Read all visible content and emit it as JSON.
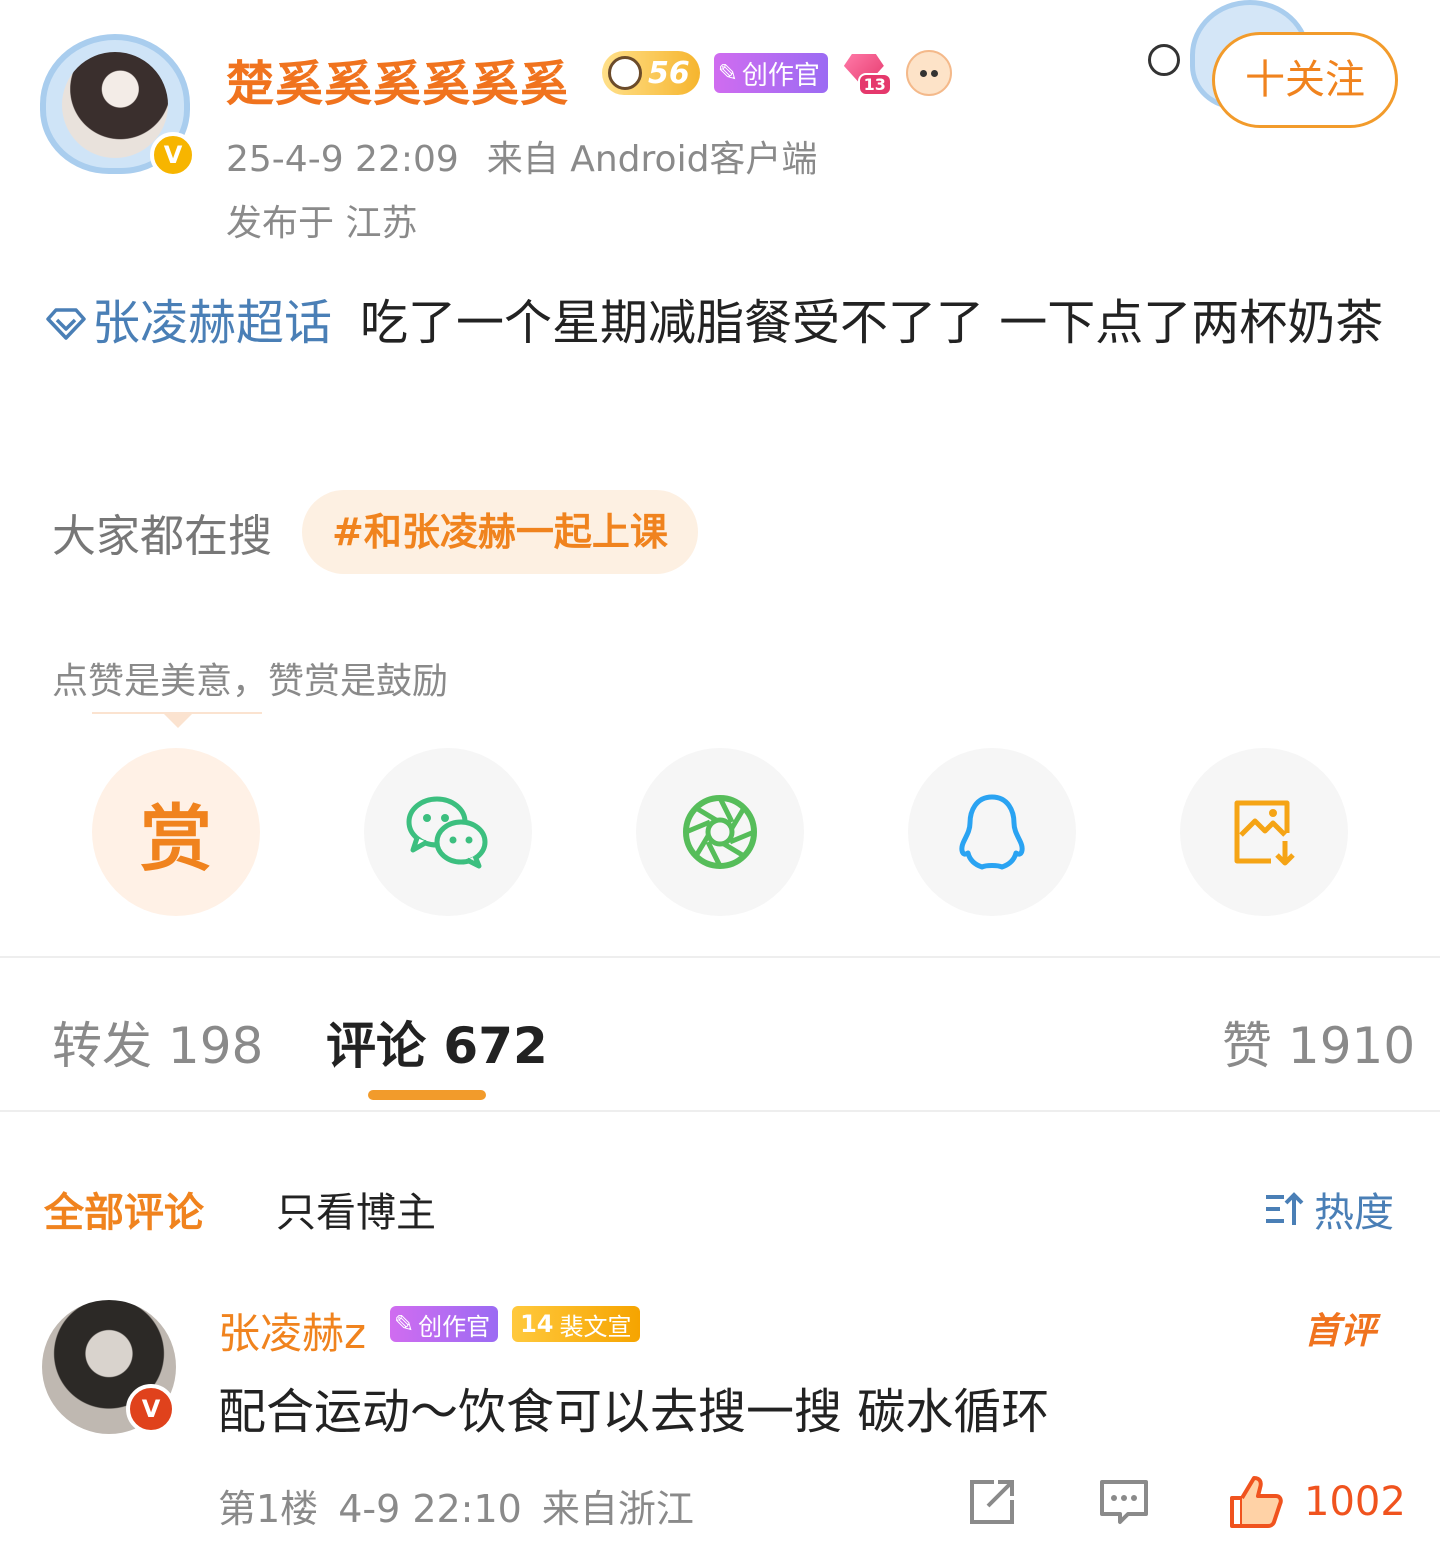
{
  "post": {
    "author": "楚奚奚奚奚奚奚",
    "level_badge": "56",
    "creator_badge": "创作官",
    "gem_level": "13",
    "follow_label": "十关注",
    "time": "25-4-9 22:09",
    "source": "来自 Android客户端",
    "location": "发布于 江苏",
    "topic": "张凌赫超话",
    "text": "吃了一个星期减脂餐受不了了 一下点了两杯奶茶",
    "search_label": "大家都在搜",
    "search_chip": "#和张凌赫一起上课",
    "reward_tip": "点赞是美意，赞赏是鼓励",
    "reward_label": "赏"
  },
  "share_icons": [
    "reward-icon",
    "wechat-icon",
    "moments-icon",
    "qq-icon",
    "save-image-icon"
  ],
  "tabs": {
    "repost": "转发 198",
    "comments": "评论 672",
    "likes": "赞 1910"
  },
  "filters": {
    "all": "全部评论",
    "owner": "只看博主",
    "sort": "热度"
  },
  "comment": {
    "author": "张凌赫z",
    "creator_badge": "创作官",
    "fan_level": "14",
    "fan_badge": "裴文宣",
    "first_label": "首评",
    "text": "配合运动～饮食可以去搜一搜 碳水循环",
    "floor": "第1楼",
    "time": "4-9 22:10",
    "location": "来自浙江",
    "likes": "1002"
  },
  "colors": {
    "accent": "#f0831e",
    "link": "#4a7fb6",
    "muted": "#8a8a8a"
  }
}
